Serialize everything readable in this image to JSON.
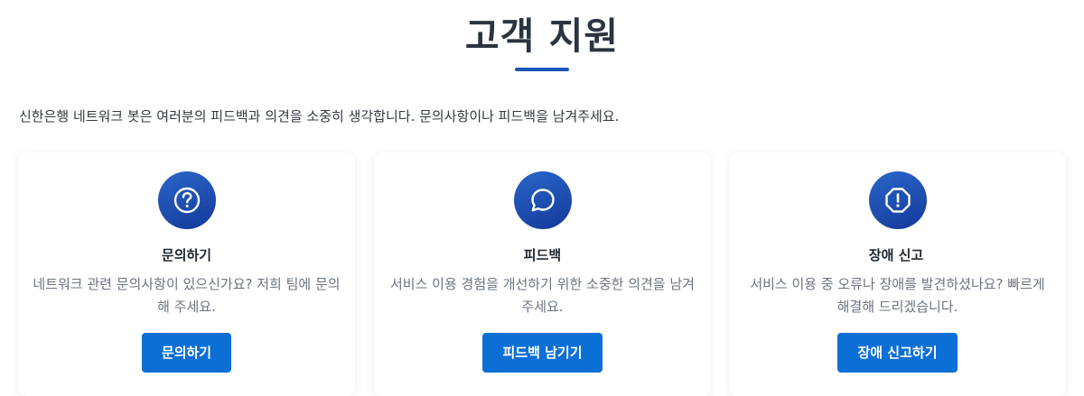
{
  "header": {
    "title": "고객 지원",
    "intro": "신한은행 네트워크 봇은 여러분의 피드백과 의견을 소중히 생각합니다. 문의사항이나 피드백을 남겨주세요."
  },
  "cards": [
    {
      "icon": "question-circle-icon",
      "title": "문의하기",
      "description": "네트워크 관련 문의사항이 있으신가요? 저희 팀에 문의해 주세요.",
      "button": "문의하기"
    },
    {
      "icon": "chat-bubble-icon",
      "title": "피드백",
      "description": "서비스 이용 경험을 개선하기 위한 소중한 의견을 남겨주세요.",
      "button": "피드백 남기기"
    },
    {
      "icon": "alert-octagon-icon",
      "title": "장애 신고",
      "description": "서비스 이용 중 오류나 장애를 발견하셨나요? 빠르게 해결해 드리겠습니다.",
      "button": "장애 신고하기"
    }
  ],
  "colors": {
    "accent": "#0c6fd6",
    "icon_gradient_start": "#2a66c9",
    "icon_gradient_end": "#14399a",
    "title_text": "#2b3440",
    "muted_text": "#6b7480"
  }
}
